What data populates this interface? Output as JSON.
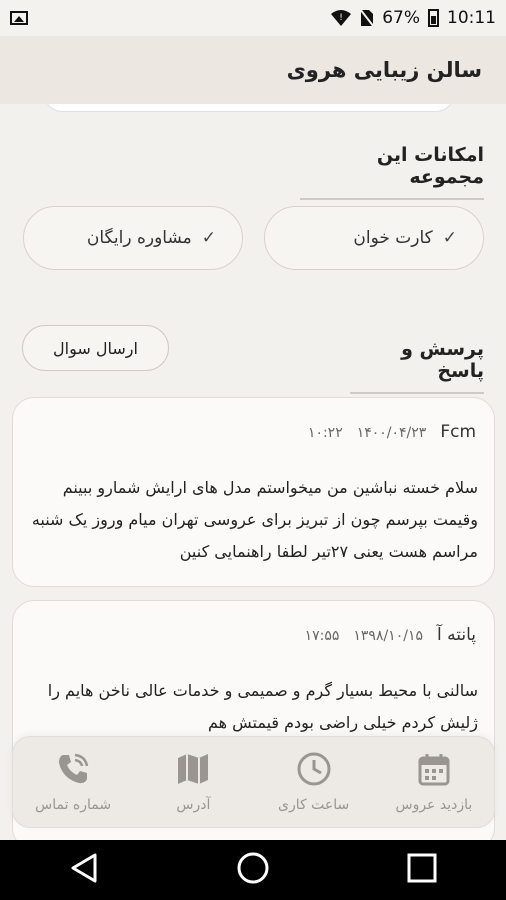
{
  "status_bar": {
    "battery": "67%",
    "time": "10:11"
  },
  "header": {
    "title": "سالن زیبایی هروی"
  },
  "facilities": {
    "title": "امکانات این مجموعه",
    "items": [
      {
        "label": "کارت خوان"
      },
      {
        "label": "مشاوره رایگان"
      }
    ]
  },
  "qa": {
    "title": "پرسش و پاسخ",
    "ask_button": "ارسال سوال",
    "questions": [
      {
        "author": "Fcm",
        "date": "۱۴۰۰/۰۴/۲۳",
        "time": "۱۰:۲۲",
        "text": "سلام خسته نباشین من میخواستم مدل های ارایش شمارو ببینم وقیمت بپرسم چون از تبریز برای عروسی تهران میام وروز یک شنبه مراسم هست یعنی ۲۷تیر لطفا راهنمایی کنین"
      },
      {
        "author": "پانته آ",
        "date": "۱۳۹۸/۱۰/۱۵",
        "time": "۱۷:۵۵",
        "text": "سالنی با محیط بسیار گرم و صمیمی و خدمات عالی ناخن هایم را ژلیش کردم خیلی راضی بودم قیمتش هم"
      }
    ]
  },
  "tabs": [
    {
      "label": "شماره تماس",
      "icon": "phone-icon"
    },
    {
      "label": "آدرس",
      "icon": "map-icon"
    },
    {
      "label": "ساعت کاری",
      "icon": "clock-icon"
    },
    {
      "label": "بازدید عروس",
      "icon": "calendar-icon"
    }
  ],
  "colors": {
    "tab_icon": "#9a9590",
    "header_bg": "#ece7e1",
    "nav_bg": "#000000"
  }
}
